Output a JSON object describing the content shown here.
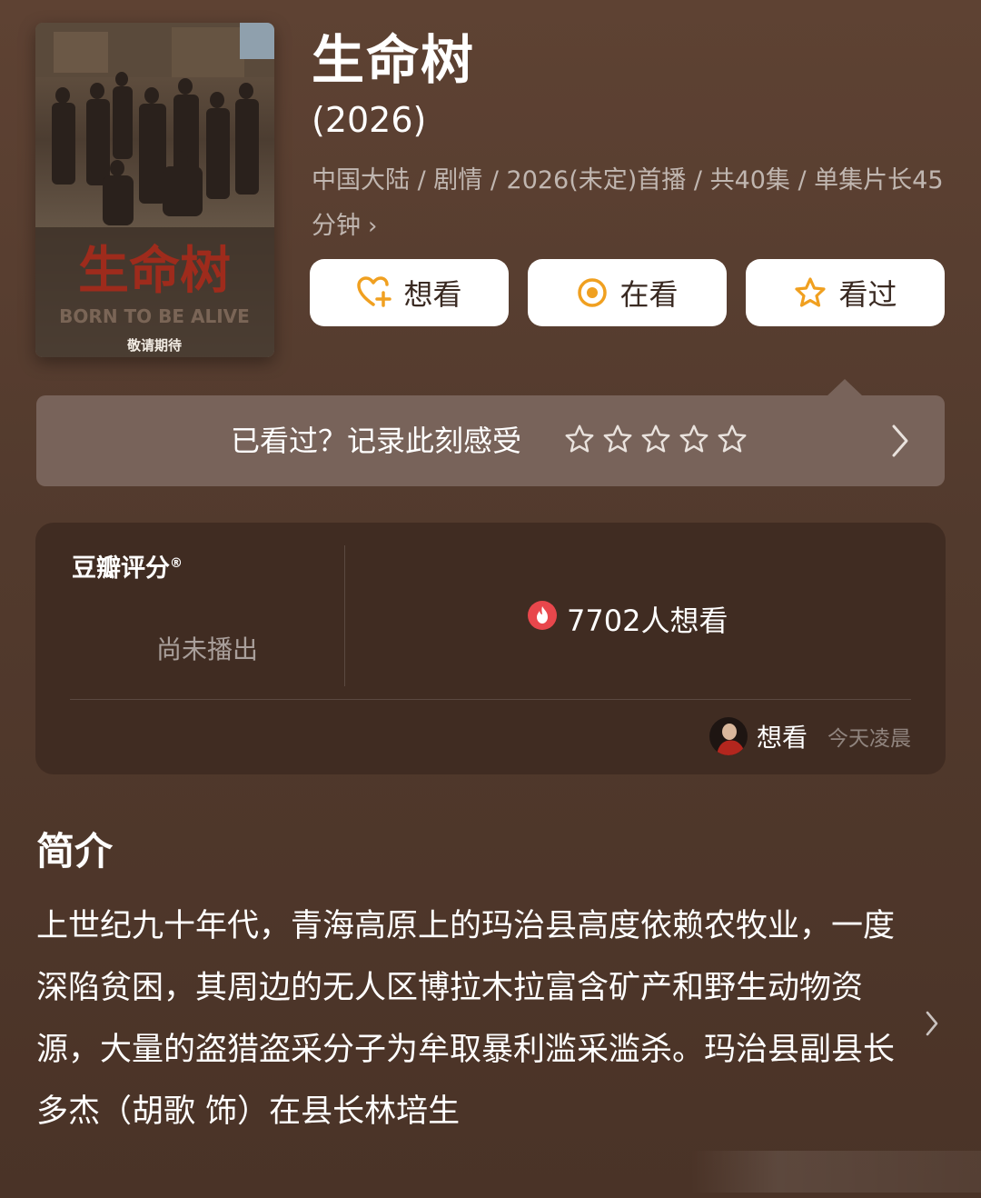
{
  "poster": {
    "title_art": "生命树",
    "subtitle_art": "BORN TO BE ALIVE",
    "tagline": "敬请期待"
  },
  "title": "生命树",
  "year": "(2026)",
  "meta": {
    "text": "中国大陆 / 剧情 / 2026(未定)首播 / 共40集 / 单集片长45分钟",
    "chevron": "›"
  },
  "buttons": [
    {
      "label": "想看",
      "icon": "heart-plus-icon"
    },
    {
      "label": "在看",
      "icon": "target-circle-icon"
    },
    {
      "label": "看过",
      "icon": "star-icon"
    }
  ],
  "rating_prompt": {
    "text": "已看过？记录此刻感受",
    "stars": 5,
    "icon": "star-outline-icon"
  },
  "score": {
    "title": "豆瓣评分",
    "registered_mark": "®",
    "status": "尚未播出",
    "want_count_text": "7702人想看",
    "want_icon": "fire-icon"
  },
  "activity": {
    "label": "想看",
    "time": "今天凌晨"
  },
  "intro": {
    "heading": "简介",
    "text": "上世纪九十年代，青海高原上的玛治县高度依赖农牧业，一度深陷贫困，其周边的无人区博拉木拉富含矿产和野生动物资源，大量的盗猎盗采分子为牟取暴利滥采滥杀。玛治县副县长多杰（胡歌 饰）在县长林培生"
  },
  "colors": {
    "background": "#5e4233",
    "accent": "#f0a020",
    "fire": "#e8474c"
  }
}
